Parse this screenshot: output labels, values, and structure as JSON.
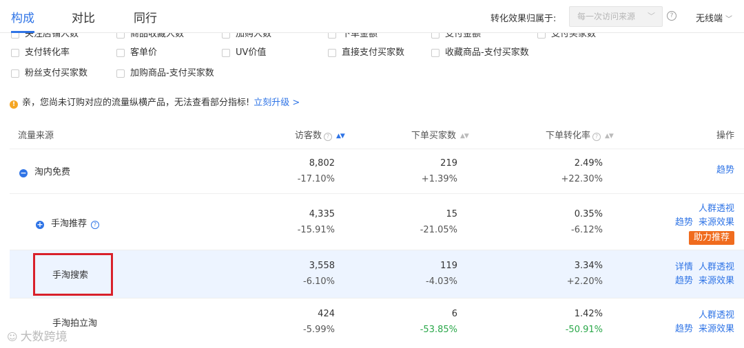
{
  "tabs": [
    "构成",
    "对比",
    "同行"
  ],
  "header": {
    "conversion_label": "转化效果归属于:",
    "conversion_select": "每一次访问来源",
    "device_select": "无线端"
  },
  "metric_checkboxes": {
    "row1": [
      "关注店铺人数",
      "商品收藏人数",
      "加购人数",
      "下单金额",
      "支付金额",
      "支付买家数"
    ],
    "row2": [
      "支付转化率",
      "客单价",
      "UV价值",
      "直接支付买家数",
      "收藏商品-支付买家数"
    ],
    "row3": [
      "粉丝支付买家数",
      "加购商品-支付买家数"
    ]
  },
  "notice": {
    "text": "亲，您尚未订购对应的流量纵横产品，无法查看部分指标!",
    "link": "立刻升级 >"
  },
  "table": {
    "columns": [
      "流量来源",
      "访客数",
      "下单买家数",
      "下单转化率",
      "操作"
    ],
    "rows": [
      {
        "name": "淘内免费",
        "visitors": "8,802",
        "visitors_chg": "-17.10%",
        "buyers": "219",
        "buyers_chg": "+1.39%",
        "rate": "2.49%",
        "rate_chg": "+22.30%",
        "ops": [
          "趋势"
        ]
      },
      {
        "name": "手淘推荐",
        "visitors": "4,335",
        "visitors_chg": "-15.91%",
        "buyers": "15",
        "buyers_chg": "-21.05%",
        "rate": "0.35%",
        "rate_chg": "-6.12%",
        "ops": [
          "人群透视",
          "趋势",
          "来源效果"
        ],
        "assist": "助力推荐"
      },
      {
        "name": "手淘搜索",
        "visitors": "3,558",
        "visitors_chg": "-6.10%",
        "buyers": "119",
        "buyers_chg": "-4.03%",
        "rate": "3.34%",
        "rate_chg": "+2.20%",
        "ops": [
          "详情",
          "人群透视",
          "趋势",
          "来源效果"
        ]
      },
      {
        "name": "手淘拍立淘",
        "visitors": "424",
        "visitors_chg": "-5.99%",
        "buyers": "6",
        "buyers_chg": "-53.85%",
        "rate": "1.42%",
        "rate_chg": "-50.91%",
        "ops": [
          "人群透视",
          "趋势",
          "来源效果"
        ]
      }
    ]
  },
  "watermark": "大数跨境",
  "colors": {
    "accent": "#2f74e6",
    "assist": "#f06c1e",
    "highlight": "#edf4ff",
    "red_box": "#d9202a",
    "negative_strong": "#2ba84a"
  }
}
